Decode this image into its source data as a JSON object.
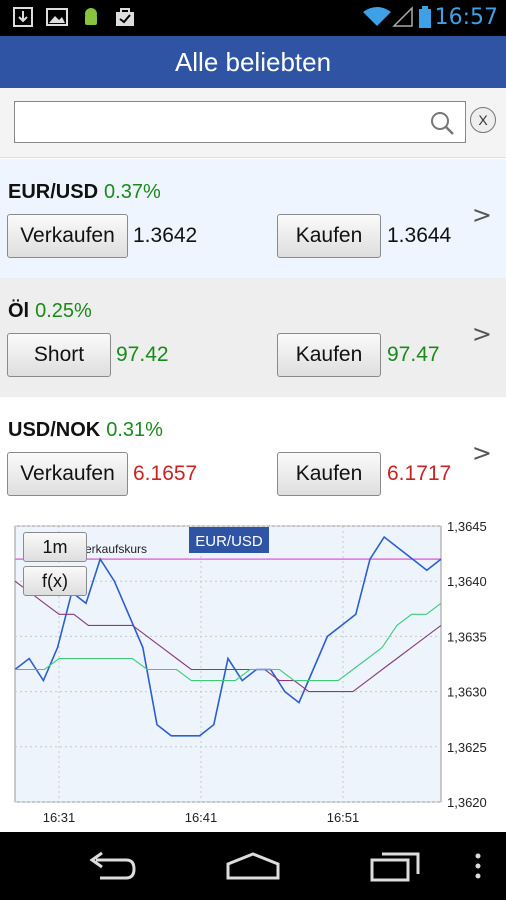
{
  "status": {
    "time": "16:57",
    "icons": [
      "download-icon",
      "image-icon",
      "android-icon",
      "shopping-bag-icon",
      "wifi-icon",
      "signal-icon",
      "battery-icon"
    ]
  },
  "title": "Alle beliebten",
  "search": {
    "value": "",
    "placeholder": "",
    "clear_label": "X"
  },
  "rows": [
    {
      "symbol": "EUR/USD",
      "change": "0.37%",
      "sell_label": "Verkaufen",
      "sell_price": "1.3642",
      "buy_label": "Kaufen",
      "buy_price": "1.3644",
      "price_color": "#111111",
      "arrow": ">"
    },
    {
      "symbol": "Öl",
      "change": "0.25%",
      "sell_label": "Short",
      "sell_price": "97.42",
      "buy_label": "Kaufen",
      "buy_price": "97.47",
      "price_color": "#1a8a1a",
      "arrow": ">"
    },
    {
      "symbol": "USD/NOK",
      "change": "0.31%",
      "sell_label": "Verkaufen",
      "sell_price": "6.1657",
      "buy_label": "Kaufen",
      "buy_price": "6.1717",
      "price_color": "#cc2222",
      "arrow": ">"
    }
  ],
  "chart_controls": {
    "timeframe": "1m",
    "function": "f(x)",
    "overlay_label": "erkaufskurs",
    "instrument": "EUR/USD"
  },
  "chart_data": {
    "type": "line",
    "title": "EUR/USD",
    "x_ticks": [
      "16:31",
      "16:41",
      "16:51"
    ],
    "y_ticks": [
      "1,3645",
      "1,3640",
      "1,3635",
      "1,3630",
      "1,3625",
      "1,3620"
    ],
    "ylim": [
      1.362,
      1.3645
    ],
    "grid": true,
    "reference_line": 1.3642,
    "series": [
      {
        "color": "#2a5fd0",
        "values": [
          1.3632,
          1.3633,
          1.3631,
          1.3634,
          1.3639,
          1.3638,
          1.3642,
          1.364,
          1.3637,
          1.3634,
          1.3627,
          1.3626,
          1.3626,
          1.3626,
          1.3627,
          1.3633,
          1.3631,
          1.3632,
          1.3632,
          1.363,
          1.3629,
          1.3632,
          1.3635,
          1.3636,
          1.3637,
          1.3642,
          1.3644,
          1.3643,
          1.3642,
          1.3641,
          1.3642
        ]
      },
      {
        "color": "#8a3a7a",
        "values": [
          1.364,
          1.3639,
          1.3638,
          1.3637,
          1.3637,
          1.3636,
          1.3636,
          1.3636,
          1.3636,
          1.3635,
          1.3634,
          1.3633,
          1.3632,
          1.3632,
          1.3632,
          1.3632,
          1.3632,
          1.3632,
          1.3631,
          1.3631,
          1.363,
          1.363,
          1.363,
          1.363,
          1.3631,
          1.3632,
          1.3633,
          1.3634,
          1.3635,
          1.3636
        ]
      },
      {
        "color": "#3ccc7a",
        "values": [
          1.3632,
          1.3632,
          1.3632,
          1.3633,
          1.3633,
          1.3633,
          1.3633,
          1.3633,
          1.3633,
          1.3632,
          1.3632,
          1.3632,
          1.3631,
          1.3631,
          1.3631,
          1.3631,
          1.3632,
          1.3632,
          1.3632,
          1.3631,
          1.3631,
          1.3631,
          1.3631,
          1.3632,
          1.3633,
          1.3634,
          1.3636,
          1.3637,
          1.3637,
          1.3638
        ]
      }
    ]
  },
  "nav": {
    "icons": [
      "back-icon",
      "home-icon",
      "recent-apps-icon",
      "menu-icon"
    ]
  }
}
